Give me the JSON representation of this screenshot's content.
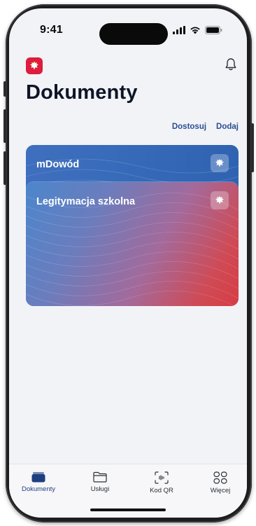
{
  "status_bar": {
    "time": "9:41"
  },
  "page": {
    "title": "Dokumenty"
  },
  "actions": {
    "customize": "Dostosuj",
    "add": "Dodaj"
  },
  "cards": [
    {
      "label": "mDowód",
      "color_start": "#3f6fbe",
      "color_end": "#2f63b2"
    },
    {
      "label": "Legitymacja szkolna",
      "color_start": "#4b86cc",
      "color_end": "#d73c44"
    }
  ],
  "tabbar": [
    {
      "label": "Dokumenty",
      "icon": "wallet-icon",
      "active": true
    },
    {
      "label": "Usługi",
      "icon": "folder-icon",
      "active": false
    },
    {
      "label": "Kod QR",
      "icon": "qr-scan-icon",
      "active": false
    },
    {
      "label": "Więcej",
      "icon": "more-grid-icon",
      "active": false
    }
  ],
  "colors": {
    "brand_red": "#dc1d3b",
    "accent_blue": "#2a4f92",
    "tab_active": "#1f3f80"
  }
}
